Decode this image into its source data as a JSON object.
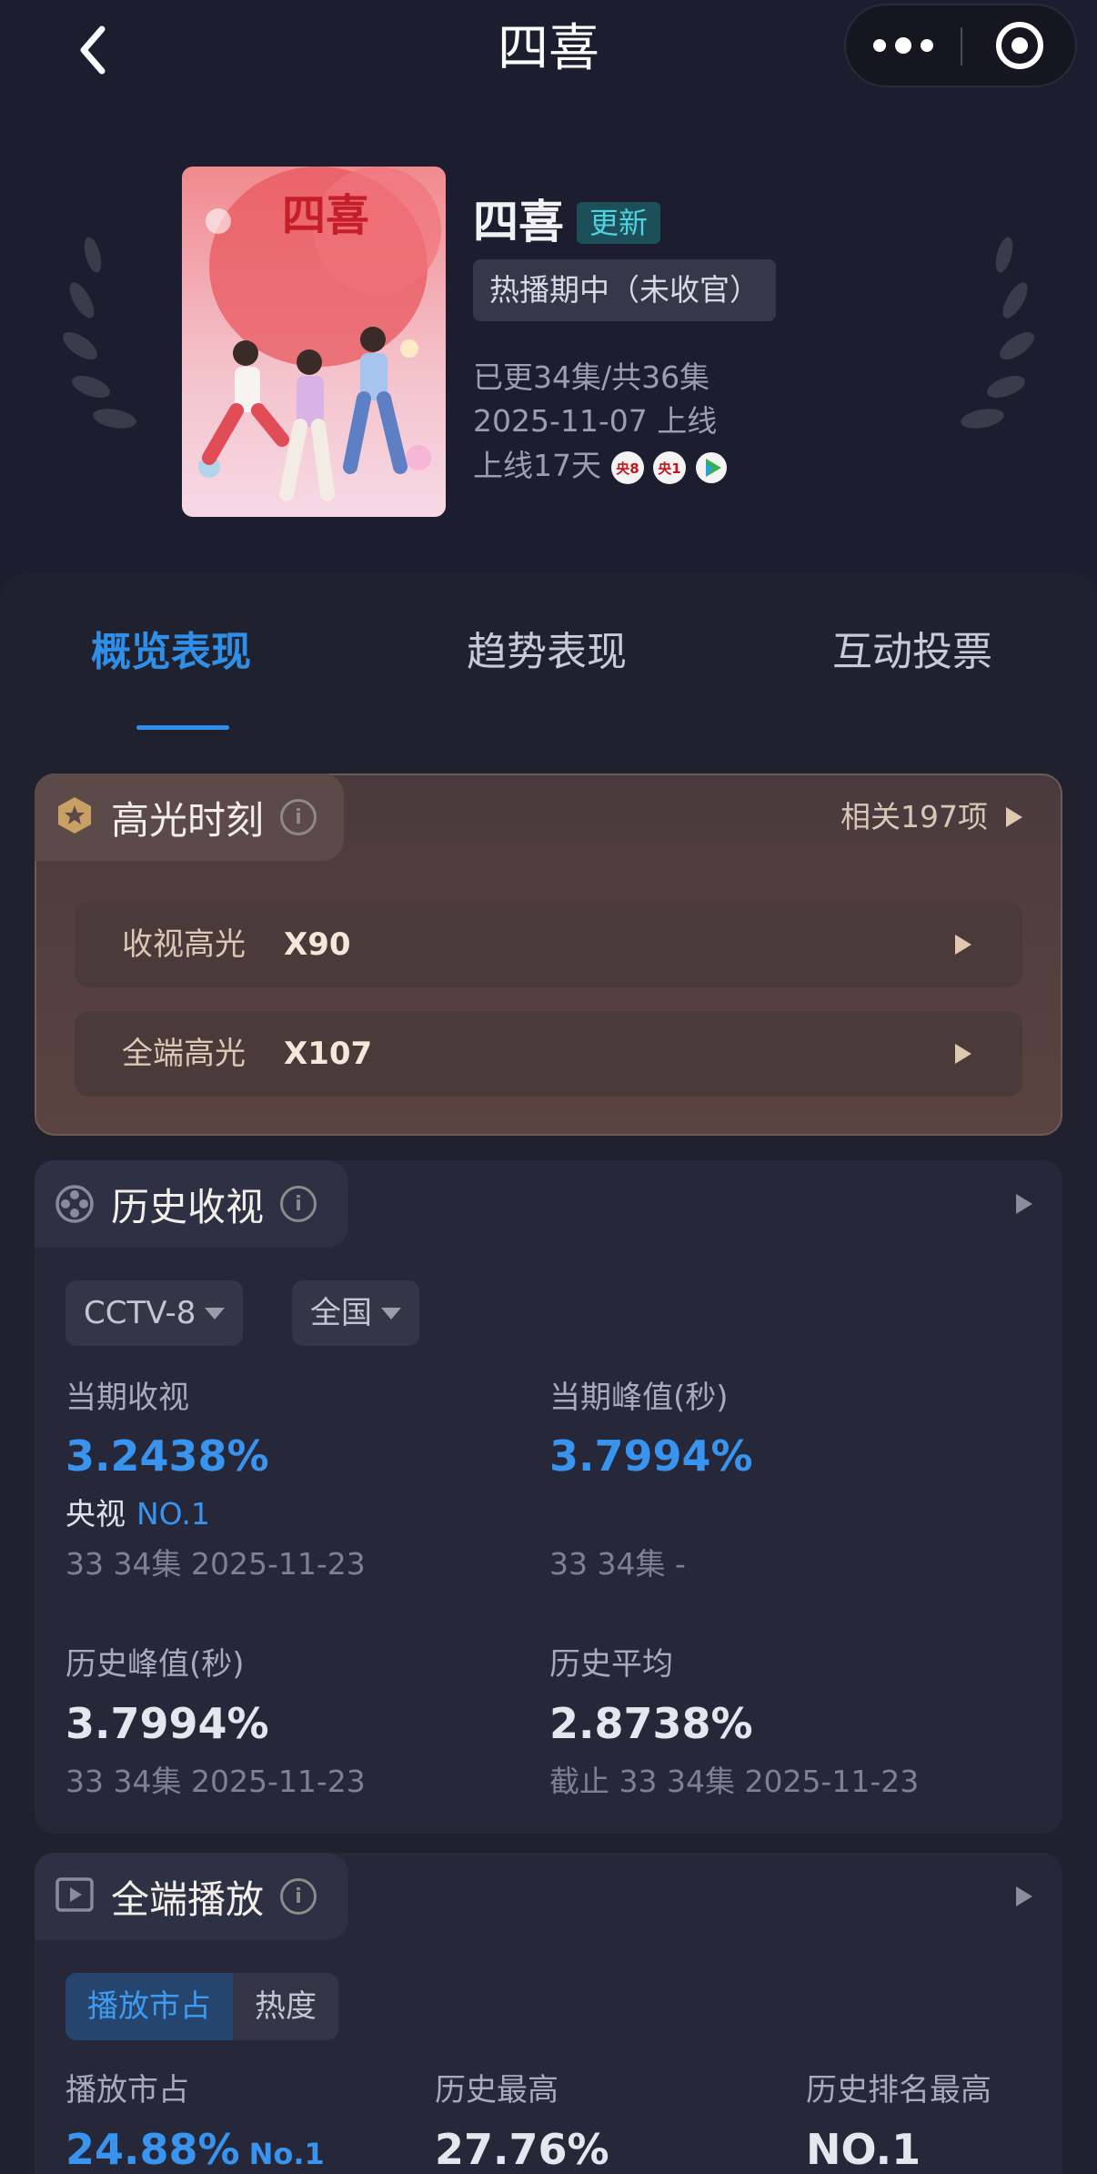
{
  "header": {
    "title": "四喜"
  },
  "show": {
    "name": "四喜",
    "badge": "更新",
    "status": "热播期中（未收官）",
    "episodes": "已更34集/共36集",
    "release": "2025-11-07 上线",
    "days_online": "上线17天",
    "channels": [
      "央8",
      "央1"
    ],
    "poster_text": "四喜"
  },
  "tabs": [
    "概览表现",
    "趋势表现",
    "互动投票"
  ],
  "highlight": {
    "title": "高光时刻",
    "related": "相关197项",
    "rows": [
      {
        "label": "收视高光",
        "value": "X90"
      },
      {
        "label": "全端高光",
        "value": "X107"
      }
    ]
  },
  "history": {
    "title": "历史收视",
    "channel_select": "CCTV-8",
    "region_select": "全国",
    "current_rating": {
      "label": "当期收视",
      "value": "3.2438%",
      "rank_prefix": "央视",
      "rank": "NO.1",
      "sub": "33 34集 2025-11-23"
    },
    "current_peak": {
      "label": "当期峰值(秒)",
      "value": "3.7994%",
      "sub": "33 34集 -"
    },
    "history_peak": {
      "label": "历史峰值(秒)",
      "value": "3.7994%",
      "sub": "33 34集 2025-11-23"
    },
    "history_avg": {
      "label": "历史平均",
      "value": "2.8738%",
      "sub": "截止 33 34集 2025-11-23"
    }
  },
  "full_platform": {
    "title": "全端播放",
    "segments": [
      "播放市占",
      "热度"
    ],
    "share": {
      "label": "播放市占",
      "value": "24.88%",
      "rank": "No.1"
    },
    "history_high": {
      "label": "历史最高",
      "value": "27.76%"
    },
    "history_rank": {
      "label": "历史排名最高",
      "value": "NO.1"
    }
  },
  "colors": {
    "background": "#1c1d2e",
    "accent_blue": "#2f8fe8",
    "highlight_gold": "#d9c7b6"
  }
}
